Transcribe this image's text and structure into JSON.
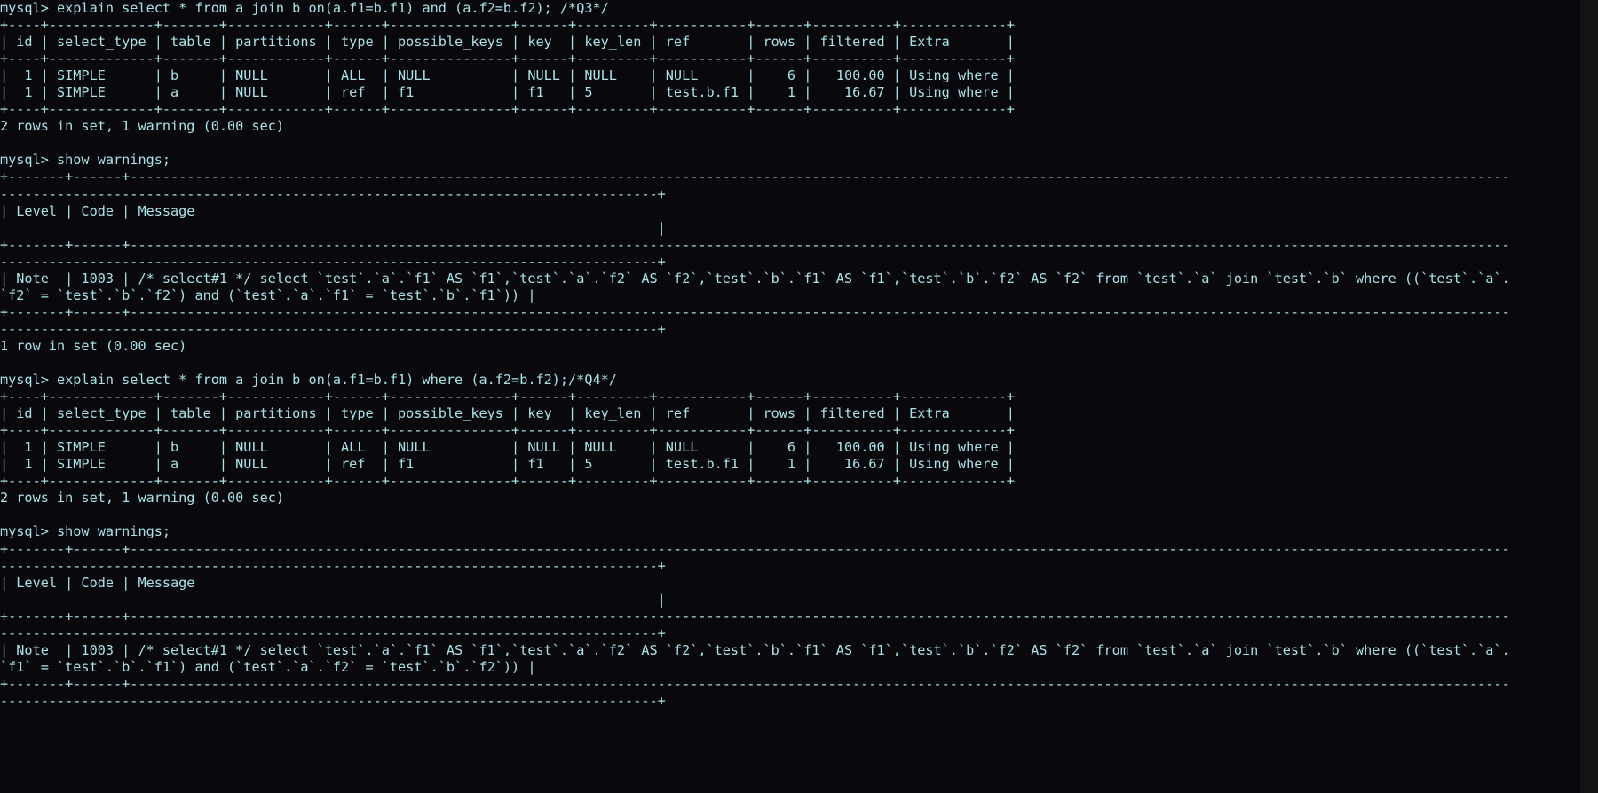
{
  "terminal": {
    "prompt": "mysql>",
    "foreground_color": "#a9e2e6",
    "background_color": "#08080d",
    "scrollbar_color": "#131314",
    "columns": 186,
    "rows": 47,
    "lines": [
      "mysql> explain select * from a join b on(a.f1=b.f1) and (a.f2=b.f2); /*Q3*/",
      "+----+-------------+-------+------------+------+---------------+------+---------+-----------+------+----------+-------------+",
      "| id | select_type | table | partitions | type | possible_keys | key  | key_len | ref       | rows | filtered | Extra       |",
      "+----+-------------+-------+------------+------+---------------+------+---------+-----------+------+----------+-------------+",
      "|  1 | SIMPLE      | b     | NULL       | ALL  | NULL          | NULL | NULL    | NULL      |    6 |   100.00 | Using where |",
      "|  1 | SIMPLE      | a     | NULL       | ref  | f1            | f1   | 5       | test.b.f1 |    1 |    16.67 | Using where |",
      "+----+-------------+-------+------------+------+---------------+------+---------+-----------+------+----------+-------------+",
      "2 rows in set, 1 warning (0.00 sec)",
      "",
      "mysql> show warnings;",
      "+-------+------+-----------------------------------------------------------------------------------------------------------------------------------------------------------------------------------------------------------------------------------------------------------+",
      "| Level | Code | Message                                                                                                                                                                                                                                                   |",
      "+-------+------+-----------------------------------------------------------------------------------------------------------------------------------------------------------------------------------------------------------------------------------------------------------+",
      "| Note  | 1003 | /* select#1 */ select `test`.`a`.`f1` AS `f1`,`test`.`a`.`f2` AS `f2`,`test`.`b`.`f1` AS `f1`,`test`.`b`.`f2` AS `f2` from `test`.`a` join `test`.`b` where ((`test`.`a`.`f2` = `test`.`b`.`f2`) and (`test`.`a`.`f1` = `test`.`b`.`f1`)) |",
      "+-------+------+-----------------------------------------------------------------------------------------------------------------------------------------------------------------------------------------------------------------------------------------------------------+",
      "1 row in set (0.00 sec)",
      "",
      "mysql> explain select * from a join b on(a.f1=b.f1) where (a.f2=b.f2);/*Q4*/",
      "+----+-------------+-------+------------+------+---------------+------+---------+-----------+------+----------+-------------+",
      "| id | select_type | table | partitions | type | possible_keys | key  | key_len | ref       | rows | filtered | Extra       |",
      "+----+-------------+-------+------------+------+---------------+------+---------+-----------+------+----------+-------------+",
      "|  1 | SIMPLE      | b     | NULL       | ALL  | NULL          | NULL | NULL    | NULL      |    6 |   100.00 | Using where |",
      "|  1 | SIMPLE      | a     | NULL       | ref  | f1            | f1   | 5       | test.b.f1 |    1 |    16.67 | Using where |",
      "+----+-------------+-------+------------+------+---------------+------+---------+-----------+------+----------+-------------+",
      "2 rows in set, 1 warning (0.00 sec)",
      "",
      "mysql> show warnings;",
      "+-------+------+-----------------------------------------------------------------------------------------------------------------------------------------------------------------------------------------------------------------------------------------------------------+",
      "| Level | Code | Message                                                                                                                                                                                                                                                   |",
      "+-------+------+-----------------------------------------------------------------------------------------------------------------------------------------------------------------------------------------------------------------------------------------------------------+",
      "| Note  | 1003 | /* select#1 */ select `test`.`a`.`f1` AS `f1`,`test`.`a`.`f2` AS `f2`,`test`.`b`.`f1` AS `f1`,`test`.`b`.`f2` AS `f2` from `test`.`a` join `test`.`b` where ((`test`.`a`.`f1` = `test`.`b`.`f1`) and (`test`.`a`.`f2` = `test`.`b`.`f2`)) |",
      "+-------+------+-----------------------------------------------------------------------------------------------------------------------------------------------------------------------------------------------------------------------------------------------------------+"
    ],
    "queries": [
      {
        "label": "Q3",
        "command": "explain select * from a join b on(a.f1=b.f1) and (a.f2=b.f2); /*Q3*/",
        "result_status": "2 rows in set, 1 warning (0.00 sec)",
        "explain": {
          "columns": [
            "id",
            "select_type",
            "table",
            "partitions",
            "type",
            "possible_keys",
            "key",
            "key_len",
            "ref",
            "rows",
            "filtered",
            "Extra"
          ],
          "rows": [
            [
              "1",
              "SIMPLE",
              "b",
              "NULL",
              "ALL",
              "NULL",
              "NULL",
              "NULL",
              "NULL",
              "6",
              "100.00",
              "Using where"
            ],
            [
              "1",
              "SIMPLE",
              "a",
              "NULL",
              "ref",
              "f1",
              "f1",
              "5",
              "test.b.f1",
              "1",
              "16.67",
              "Using where"
            ]
          ]
        },
        "warnings_command": "show warnings;",
        "warnings": {
          "columns": [
            "Level",
            "Code",
            "Message"
          ],
          "rows": [
            [
              "Note",
              "1003",
              "/* select#1 */ select `test`.`a`.`f1` AS `f1`,`test`.`a`.`f2` AS `f2`,`test`.`b`.`f1` AS `f1`,`test`.`b`.`f2` AS `f2` from `test`.`a` join `test`.`b` where ((`test`.`a`.`f2` = `test`.`b`.`f2`) and (`test`.`a`.`f1` = `test`.`b`.`f1`))"
            ]
          ],
          "result_status": "1 row in set (0.00 sec)"
        }
      },
      {
        "label": "Q4",
        "command": "explain select * from a join b on(a.f1=b.f1) where (a.f2=b.f2);/*Q4*/",
        "result_status": "2 rows in set, 1 warning (0.00 sec)",
        "explain": {
          "columns": [
            "id",
            "select_type",
            "table",
            "partitions",
            "type",
            "possible_keys",
            "key",
            "key_len",
            "ref",
            "rows",
            "filtered",
            "Extra"
          ],
          "rows": [
            [
              "1",
              "SIMPLE",
              "b",
              "NULL",
              "ALL",
              "NULL",
              "NULL",
              "NULL",
              "NULL",
              "6",
              "100.00",
              "Using where"
            ],
            [
              "1",
              "SIMPLE",
              "a",
              "NULL",
              "ref",
              "f1",
              "f1",
              "5",
              "test.b.f1",
              "1",
              "16.67",
              "Using where"
            ]
          ]
        },
        "warnings_command": "show warnings;",
        "warnings": {
          "columns": [
            "Level",
            "Code",
            "Message"
          ],
          "rows": [
            [
              "Note",
              "1003",
              "/* select#1 */ select `test`.`a`.`f1` AS `f1`,`test`.`a`.`f2` AS `f2`,`test`.`b`.`f1` AS `f1`,`test`.`b`.`f2` AS `f2` from `test`.`a` join `test`.`b` where ((`test`.`a`.`f1` = `test`.`b`.`f1`) and (`test`.`a`.`f2` = `test`.`b`.`f2`))"
            ]
          ]
        }
      }
    ]
  }
}
